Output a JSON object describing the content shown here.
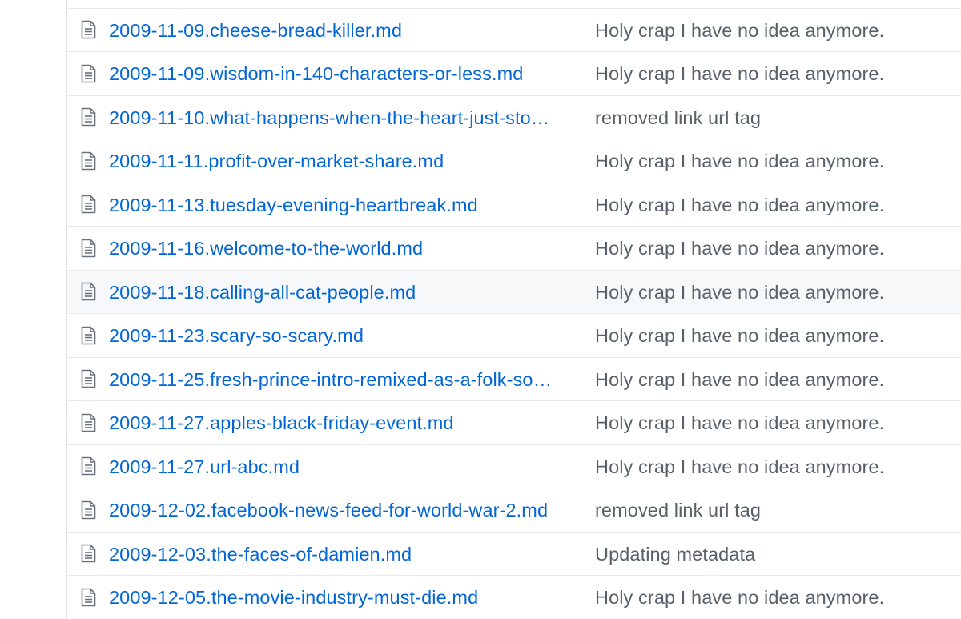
{
  "file_list": {
    "rows": [
      {
        "name": "",
        "message": ""
      },
      {
        "name": "2009-11-09.cheese-bread-killer.md",
        "message": "Holy crap I have no idea anymore."
      },
      {
        "name": "2009-11-09.wisdom-in-140-characters-or-less.md",
        "message": "Holy crap I have no idea anymore."
      },
      {
        "name": "2009-11-10.what-happens-when-the-heart-just-sto…",
        "message": "removed link url tag"
      },
      {
        "name": "2009-11-11.profit-over-market-share.md",
        "message": "Holy crap I have no idea anymore."
      },
      {
        "name": "2009-11-13.tuesday-evening-heartbreak.md",
        "message": "Holy crap I have no idea anymore."
      },
      {
        "name": "2009-11-16.welcome-to-the-world.md",
        "message": "Holy crap I have no idea anymore."
      },
      {
        "name": "2009-11-18.calling-all-cat-people.md",
        "message": "Holy crap I have no idea anymore."
      },
      {
        "name": "2009-11-23.scary-so-scary.md",
        "message": "Holy crap I have no idea anymore."
      },
      {
        "name": "2009-11-25.fresh-prince-intro-remixed-as-a-folk-so…",
        "message": "Holy crap I have no idea anymore."
      },
      {
        "name": "2009-11-27.apples-black-friday-event.md",
        "message": "Holy crap I have no idea anymore."
      },
      {
        "name": "2009-11-27.url-abc.md",
        "message": "Holy crap I have no idea anymore."
      },
      {
        "name": "2009-12-02.facebook-news-feed-for-world-war-2.md",
        "message": "removed link url tag"
      },
      {
        "name": "2009-12-03.the-faces-of-damien.md",
        "message": "Updating metadata"
      },
      {
        "name": "2009-12-05.the-movie-industry-must-die.md",
        "message": "Holy crap I have no idea anymore."
      }
    ],
    "icon": "file-text-icon",
    "colors": {
      "link": "#0366d6",
      "message": "#586069",
      "icon": "#6a737d",
      "row_border": "#e9ecef",
      "row_hover": "#f6f8fa"
    }
  }
}
